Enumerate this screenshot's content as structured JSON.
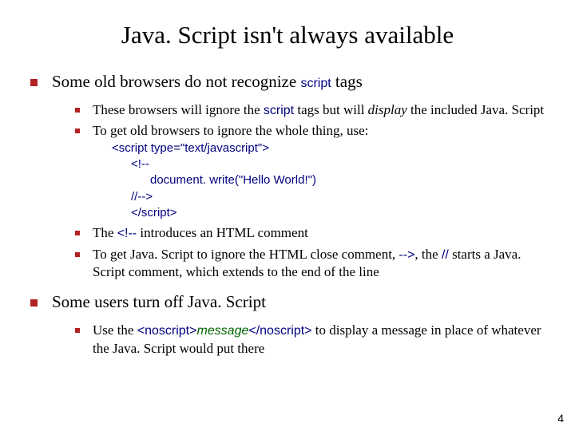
{
  "title": "Java. Script isn't always available",
  "main1": {
    "text_a": "Some old browsers do not recognize ",
    "code_a": "script",
    "text_b": " tags"
  },
  "sub1": {
    "text_a": "These browsers will ignore the ",
    "code_a": "script",
    "text_b": " tags but will ",
    "ital_a": "display",
    "text_c": " the included Java. Script"
  },
  "sub2": {
    "text_a": "To get old browsers to ignore the whole thing, use:",
    "code": {
      "l1": "<script type=\"text/javascript\">",
      "l2": "<!--",
      "l3": "document. write(\"Hello World!\")",
      "l4": "//-->",
      "l5a": "</scr",
      "l5b": "ipt>"
    }
  },
  "sub3": {
    "text_a": "The ",
    "code_a": "<!--",
    "text_b": " introduces an HTML comment"
  },
  "sub4": {
    "text_a": "To get Java. Script to ignore the HTML close comment, ",
    "code_a": "-->",
    "text_b": ", the ",
    "code_b": "//",
    "text_c": " starts a Java. Script comment, which extends to the end of the line"
  },
  "main2": {
    "text_a": "Some users turn off Java. Script"
  },
  "sub5": {
    "text_a": "Use the ",
    "code_a": "<noscript>",
    "ital_a": "message",
    "code_b": "</noscript>",
    "text_b": " to display a message in place of whatever the Java. Script would put there"
  },
  "pagenum": "4"
}
